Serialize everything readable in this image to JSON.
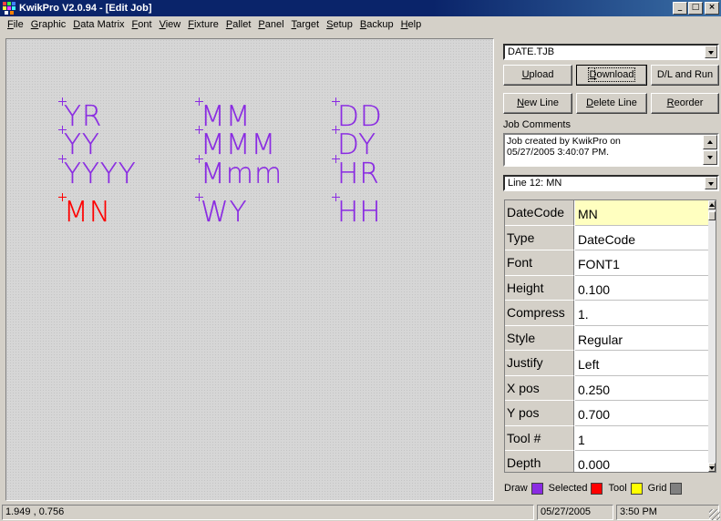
{
  "window": {
    "title": "KwikPro  V2.0.94 - [Edit Job]",
    "controls": [
      "_",
      "□",
      "×"
    ]
  },
  "menu": [
    {
      "label": "File",
      "accel": "F",
      "rest": "ile"
    },
    {
      "label": "Graphic",
      "accel": "G",
      "rest": "raphic"
    },
    {
      "label": "Data Matrix",
      "accel": "D",
      "rest": "ata Matrix"
    },
    {
      "label": "Font",
      "accel": "F",
      "rest": "ont"
    },
    {
      "label": "View",
      "accel": "V",
      "rest": "iew"
    },
    {
      "label": "Fixture",
      "accel": "F",
      "rest": "ixture"
    },
    {
      "label": "Pallet",
      "accel": "P",
      "rest": "allet"
    },
    {
      "label": "Panel",
      "accel": "P",
      "rest": "anel"
    },
    {
      "label": "Target",
      "accel": "T",
      "rest": "arget"
    },
    {
      "label": "Setup",
      "accel": "S",
      "rest": "etup"
    },
    {
      "label": "Backup",
      "accel": "B",
      "rest": "ackup"
    },
    {
      "label": "Help",
      "accel": "H",
      "rest": "elp"
    }
  ],
  "canvas": {
    "items": [
      {
        "text": "YR",
        "color": "purple"
      },
      {
        "text": "YY",
        "color": "purple"
      },
      {
        "text": "YYYY",
        "color": "purple"
      },
      {
        "text": "MN",
        "color": "red"
      },
      {
        "text": "MM",
        "color": "purple"
      },
      {
        "text": "MMM",
        "color": "purple"
      },
      {
        "text": "Mmm",
        "color": "purple"
      },
      {
        "text": "WY",
        "color": "purple"
      },
      {
        "text": "DD",
        "color": "purple"
      },
      {
        "text": "DY",
        "color": "purple"
      },
      {
        "text": "HR",
        "color": "purple"
      },
      {
        "text": "HH",
        "color": "purple"
      }
    ]
  },
  "panel": {
    "job_file": "DATE.TJB",
    "buttons": {
      "upload": {
        "accel": "U",
        "rest": "pload"
      },
      "download": {
        "accel": "D",
        "rest": "ownload"
      },
      "dl_run": "D/L and Run",
      "new_line": {
        "accel": "N",
        "rest": "ew Line"
      },
      "delete_line": {
        "accel": "D",
        "rest": "elete Line"
      },
      "reorder": {
        "accel": "R",
        "rest": "eorder"
      }
    },
    "job_comments_label": "Job Comments",
    "job_comments": "Job created by KwikPro on 05/27/2005 3:40:07 PM.",
    "line_select": "Line 12: MN",
    "properties": [
      {
        "name": "DateCode",
        "value": "MN"
      },
      {
        "name": "Type",
        "value": "DateCode"
      },
      {
        "name": "Font",
        "value": "FONT1"
      },
      {
        "name": "Height",
        "value": "0.100"
      },
      {
        "name": "Compress",
        "value": "1."
      },
      {
        "name": "Style",
        "value": "Regular"
      },
      {
        "name": "Justify",
        "value": "Left"
      },
      {
        "name": "X pos",
        "value": "0.250"
      },
      {
        "name": "Y pos",
        "value": "0.700"
      },
      {
        "name": "Tool #",
        "value": "1"
      },
      {
        "name": "Depth",
        "value": "0.000"
      }
    ],
    "legend": {
      "draw": "Draw",
      "selected": "Selected",
      "tool": "Tool",
      "grid": "Grid"
    }
  },
  "colors": {
    "purple": "#8a2be2",
    "red": "#ff0000",
    "draw": "#8a2be2",
    "selected": "#ff0000",
    "tool": "#ffff00",
    "grid": "#808080",
    "title_bar": "#0a246a"
  },
  "status": {
    "coords": "1.949 , 0.756",
    "date": "05/27/2005",
    "time": "3:50 PM"
  }
}
